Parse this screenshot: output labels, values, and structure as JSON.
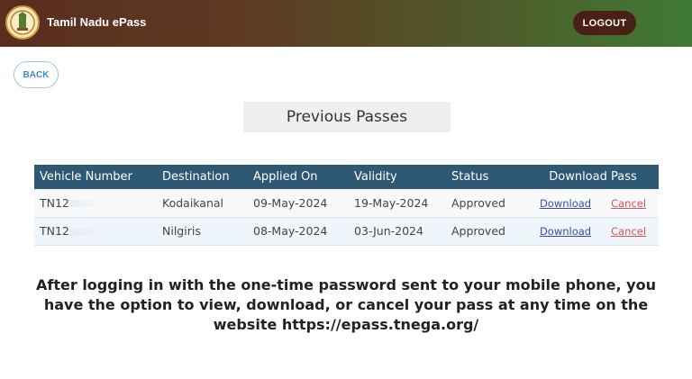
{
  "header": {
    "app_title": "Tamil Nadu ePass",
    "logout_label": "LOGOUT"
  },
  "nav": {
    "back_label": "BACK"
  },
  "page_title": "Previous Passes",
  "table": {
    "columns": [
      "Vehicle Number",
      "Destination",
      "Applied On",
      "Validity",
      "Status",
      "Download Pass"
    ],
    "rows": [
      {
        "vehicle": "TN12",
        "destination": "Kodaikanal",
        "applied_on": "09-May-2024",
        "validity": "19-May-2024",
        "status": "Approved",
        "download": "Download",
        "cancel": "Cancel"
      },
      {
        "vehicle": "TN12",
        "destination": "Nilgiris",
        "applied_on": "08-May-2024",
        "validity": "03-Jun-2024",
        "status": "Approved",
        "download": "Download",
        "cancel": "Cancel"
      }
    ]
  },
  "caption": "After logging in with the one-time password sent to your mobile phone, you have the option to view, download, or cancel your pass at any time on the website https://epass.tnega.org/",
  "colors": {
    "header_gradient_start": "#5a2d1e",
    "header_gradient_end": "#3f7a35",
    "table_header": "#2e5873",
    "logout_button": "#4a1f15",
    "download_link": "#3b4bb5",
    "cancel_link": "#d9534f"
  },
  "icons": {
    "logo": "tamil-nadu-emblem-icon"
  }
}
